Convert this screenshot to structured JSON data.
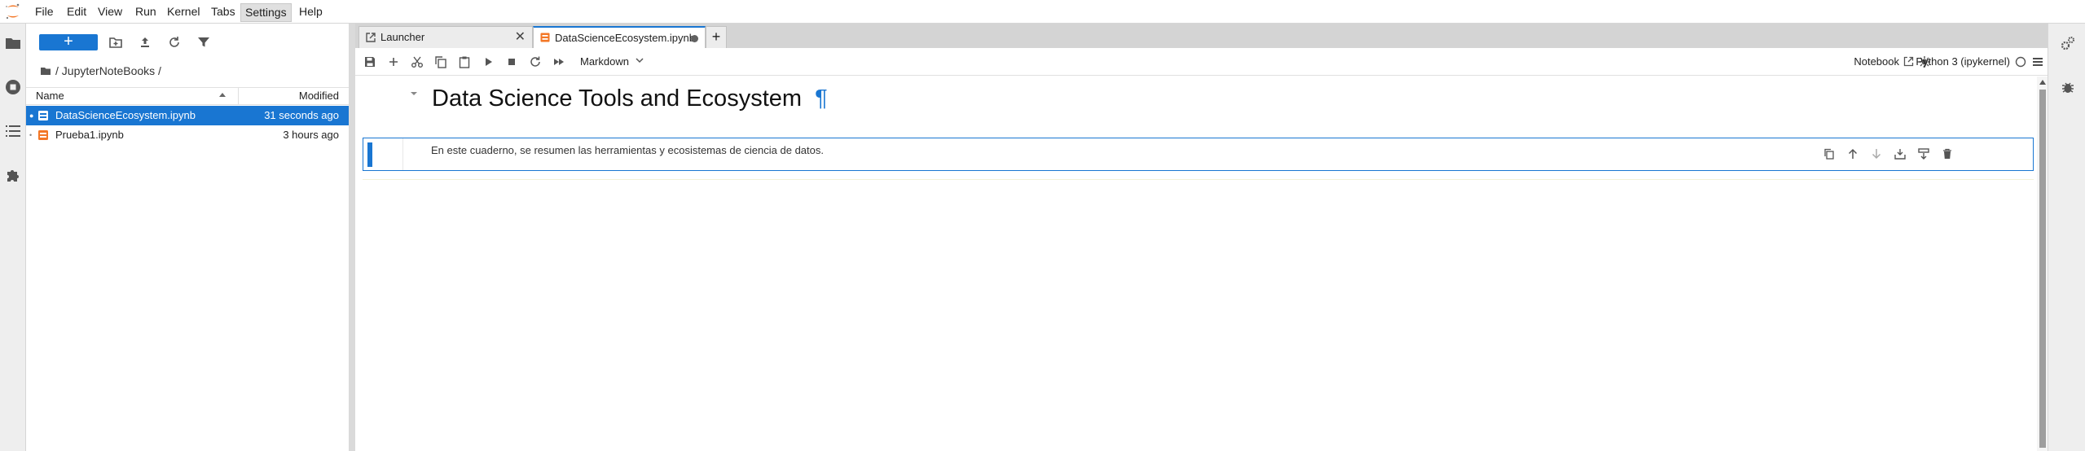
{
  "menubar": {
    "items": [
      "File",
      "Edit",
      "View",
      "Run",
      "Kernel",
      "Tabs",
      "Settings",
      "Help"
    ],
    "active": "Settings"
  },
  "filebrowser": {
    "new_label": "+",
    "breadcrumb": "/ JupyterNoteBooks /",
    "columns": {
      "name": "Name",
      "modified": "Modified"
    },
    "files": [
      {
        "name": "DataScienceEcosystem.ipynb",
        "modified": "31 seconds ago",
        "selected": true
      },
      {
        "name": "Prueba1.ipynb",
        "modified": "3 hours ago",
        "selected": false
      }
    ]
  },
  "tabs": [
    {
      "label": "Launcher",
      "icon": "launcher-icon"
    },
    {
      "label": "DataScienceEcosystem.ipynb",
      "icon": "notebook-icon",
      "active": true
    }
  ],
  "new_tab_label": "+",
  "toolbar": {
    "cell_type": "Markdown",
    "notebook_label": "Notebook",
    "kernel_name": "Python 3 (ipykernel)"
  },
  "notebook": {
    "heading": "Data Science Tools and Ecosystem",
    "heading_anchor": "¶",
    "cell_text": "En este cuaderno, se resumen las herramientas y ecosistemas de ciencia de datos."
  },
  "colors": {
    "accent": "#1976d2",
    "notebook_orange": "#f37726"
  }
}
